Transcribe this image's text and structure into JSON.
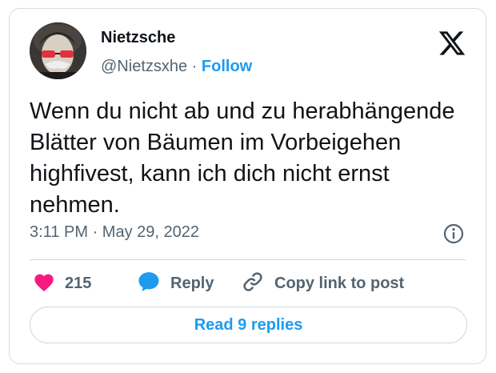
{
  "author": {
    "name": "Nietzsche",
    "handle": "@Nietzsxhe",
    "separator": "·",
    "follow_label": "Follow"
  },
  "icons": {
    "logo": "x-logo-icon",
    "info": "info-icon",
    "like": "heart-icon",
    "reply": "speech-bubble-icon",
    "copy": "link-icon"
  },
  "tweet": {
    "text": "Wenn du nicht ab und zu herabhängende Blätter von Bäumen im Vorbeigehen highfivest, kann ich dich nicht ernst nehmen."
  },
  "meta": {
    "time": "3:11 PM",
    "separator": "·",
    "date": "May 29, 2022"
  },
  "actions": {
    "likes": "215",
    "reply_label": "Reply",
    "copy_label": "Copy link to post"
  },
  "read_replies_label": "Read 9 replies",
  "colors": {
    "accent": "#1d9bf0",
    "heart": "#f91880",
    "muted_text": "#536471"
  }
}
